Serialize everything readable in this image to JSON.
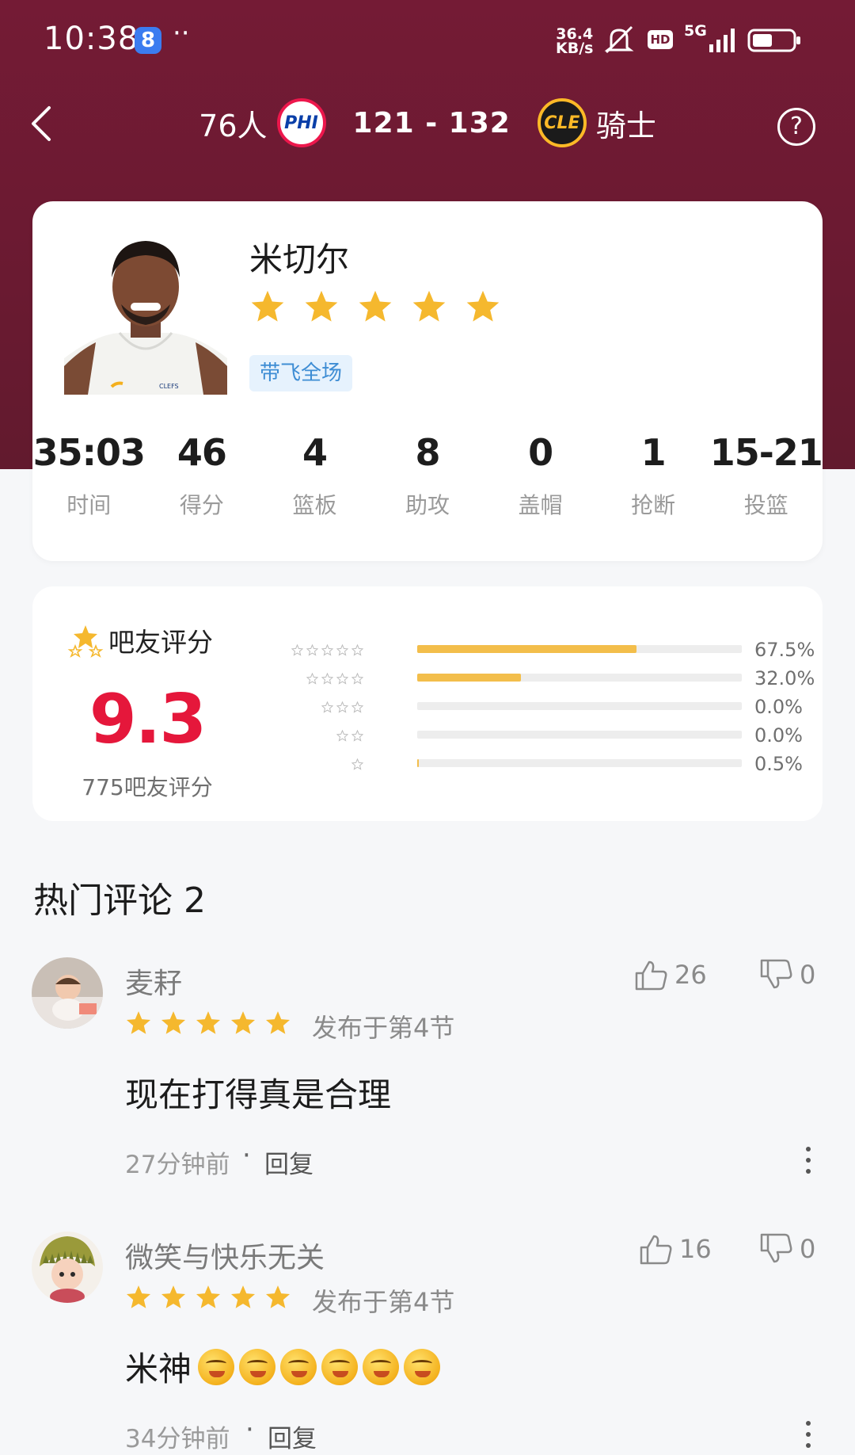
{
  "status_bar": {
    "time": "10:38",
    "app_badge": "8",
    "dots": "··",
    "speed_value": "36.4",
    "speed_unit": "KB/s",
    "hd": "HD",
    "network": "5G"
  },
  "header": {
    "home_team": "76人",
    "home_logo": "PHI",
    "score": "121 - 132",
    "away_logo": "CLE",
    "away_team": "骑士",
    "help": "?"
  },
  "player": {
    "name": "米切尔",
    "star_count": 5,
    "tag": "带飞全场",
    "stats": [
      {
        "value": "35:03",
        "label": "时间"
      },
      {
        "value": "46",
        "label": "得分"
      },
      {
        "value": "4",
        "label": "篮板"
      },
      {
        "value": "8",
        "label": "助攻"
      },
      {
        "value": "0",
        "label": "盖帽"
      },
      {
        "value": "1",
        "label": "抢断"
      },
      {
        "value": "15-21",
        "label": "投篮"
      }
    ]
  },
  "rating": {
    "title": "吧友评分",
    "score": "9.3",
    "count_label": "775吧友评分",
    "distribution": [
      {
        "stars": 5,
        "percent": 67.5,
        "label": "67.5%"
      },
      {
        "stars": 4,
        "percent": 32.0,
        "label": "32.0%"
      },
      {
        "stars": 3,
        "percent": 0.0,
        "label": "0.0%"
      },
      {
        "stars": 2,
        "percent": 0.0,
        "label": "0.0%"
      },
      {
        "stars": 1,
        "percent": 0.5,
        "label": "0.5%"
      }
    ]
  },
  "comments_section": {
    "title": "热门评论 2",
    "comments": [
      {
        "user": "麦耔",
        "stars": 5,
        "meta": "发布于第4节",
        "text": "现在打得真是合理",
        "time": "27分钟前",
        "dot": "·",
        "reply": "回复",
        "likes": "26",
        "dislikes": "0"
      },
      {
        "user": "微笑与快乐无关",
        "stars": 5,
        "meta": "发布于第4节",
        "text": "米神",
        "emoji_count": 6,
        "time": "34分钟前",
        "dot": "·",
        "reply": "回复",
        "likes": "16",
        "dislikes": "0"
      }
    ]
  },
  "colors": {
    "header_bg": "#741b35",
    "star_gold": "#f5b82e",
    "score_red": "#e5173b",
    "tag_bg": "#e6f2fd",
    "tag_text": "#3e8dd4"
  }
}
